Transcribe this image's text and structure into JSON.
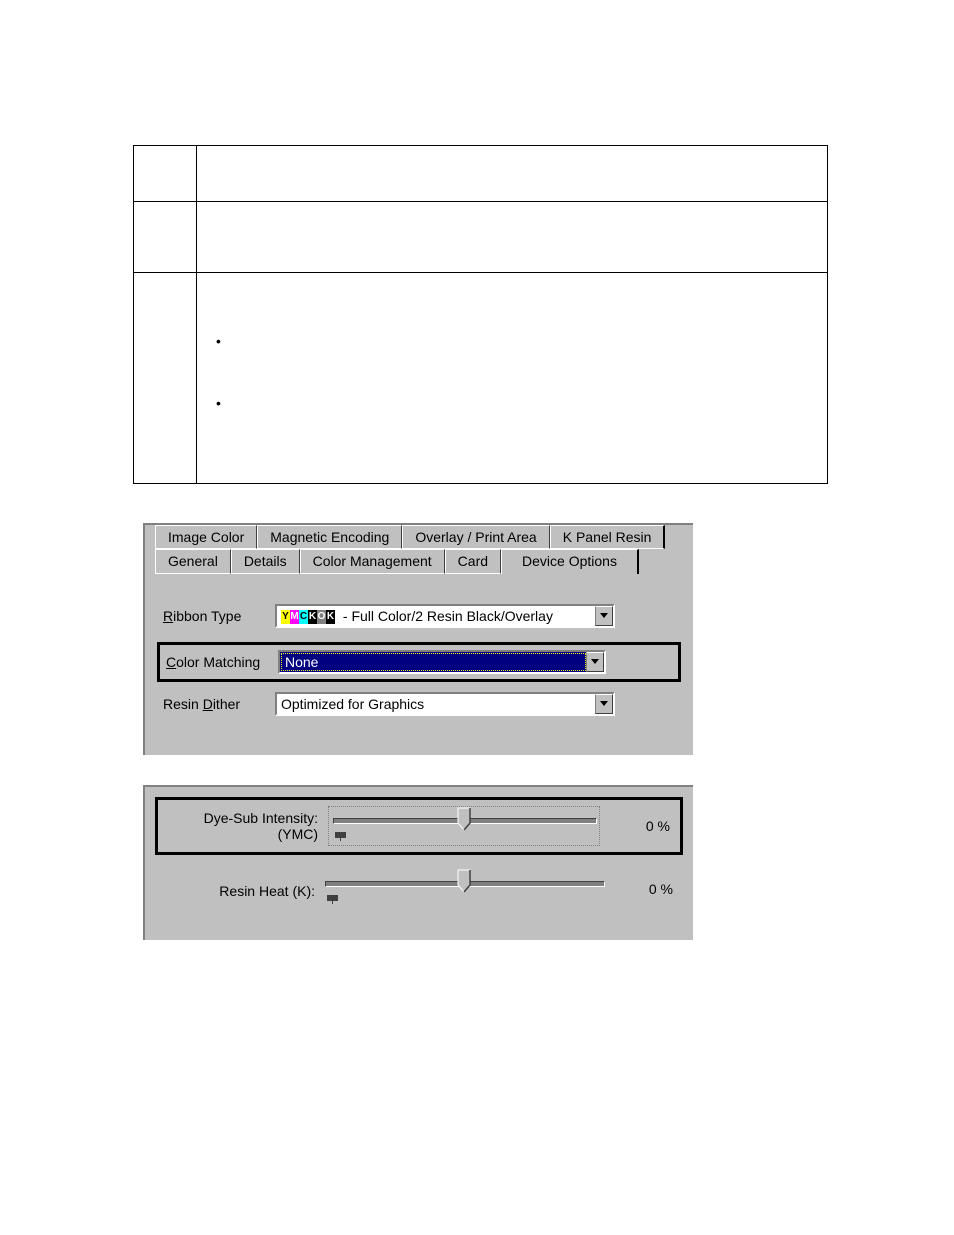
{
  "tabs_row1": [
    {
      "label": "Image Color"
    },
    {
      "label": "Magnetic Encoding"
    },
    {
      "label": "Overlay / Print Area"
    },
    {
      "label": "K Panel Resin"
    }
  ],
  "tabs_row2": [
    {
      "label": "General"
    },
    {
      "label": "Details"
    },
    {
      "label": "Color Management"
    },
    {
      "label": "Card"
    },
    {
      "label": "Device Options",
      "active": true
    }
  ],
  "form": {
    "ribbon_type": {
      "label_pre": "R",
      "label_post": "ibbon Type",
      "icon_letters": [
        "Y",
        "M",
        "C",
        "K",
        "O",
        "K"
      ],
      "value": " - Full Color/2 Resin Black/Overlay"
    },
    "color_matching": {
      "label_pre": "C",
      "label_post": "olor Matching",
      "value": "None"
    },
    "resin_dither": {
      "label_pre_plain": "Resin ",
      "label_u": "D",
      "label_post": "ither",
      "value": "Optimized for Graphics"
    }
  },
  "sliders": {
    "dye_sub": {
      "label_line1": "Dye-Sub Intensity:",
      "label_line2": "(YMC)",
      "value_text": "0  %"
    },
    "resin_heat": {
      "label": "Resin Heat  (K):",
      "value_text": "0  %"
    }
  }
}
